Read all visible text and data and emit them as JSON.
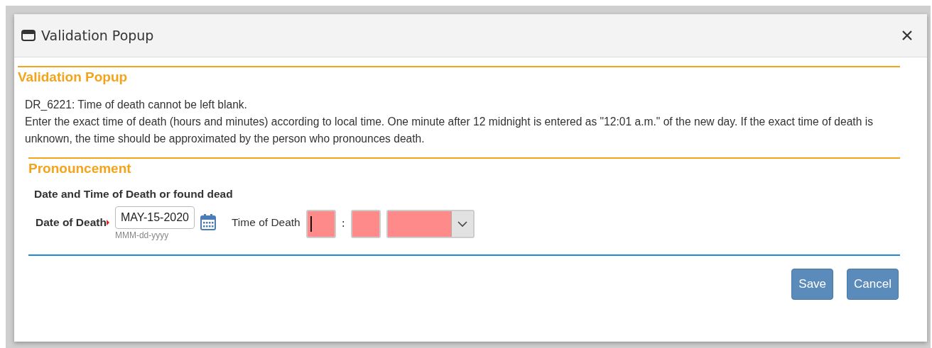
{
  "dialog": {
    "title": "Validation Popup",
    "heading": "Validation Popup",
    "messages": [
      "DR_6221: Time of death cannot be left blank.",
      "Enter the exact time of death (hours and minutes) according to local time. One minute after 12 midnight is entered as \"12:01 a.m.\" of the new day. If the exact time of death is unknown, the time should be approximated by the person who pronounces death."
    ]
  },
  "section": {
    "title": "Pronouncement",
    "group_label": "Date and Time of Death or found dead",
    "date_of_death": {
      "label": "Date of Death",
      "required": true,
      "value": "MAY-15-2020",
      "hint": "MMM-dd-yyyy"
    },
    "time_of_death": {
      "label": "Time of Death",
      "separator": ":",
      "fields": [
        {
          "kind": "text",
          "invalid": true,
          "focused": true
        },
        {
          "kind": "text",
          "invalid": true,
          "focused": false
        },
        {
          "kind": "select",
          "invalid": true,
          "focused": false
        }
      ]
    }
  },
  "buttons": [
    {
      "label": "Save"
    },
    {
      "label": "Cancel"
    }
  ]
}
